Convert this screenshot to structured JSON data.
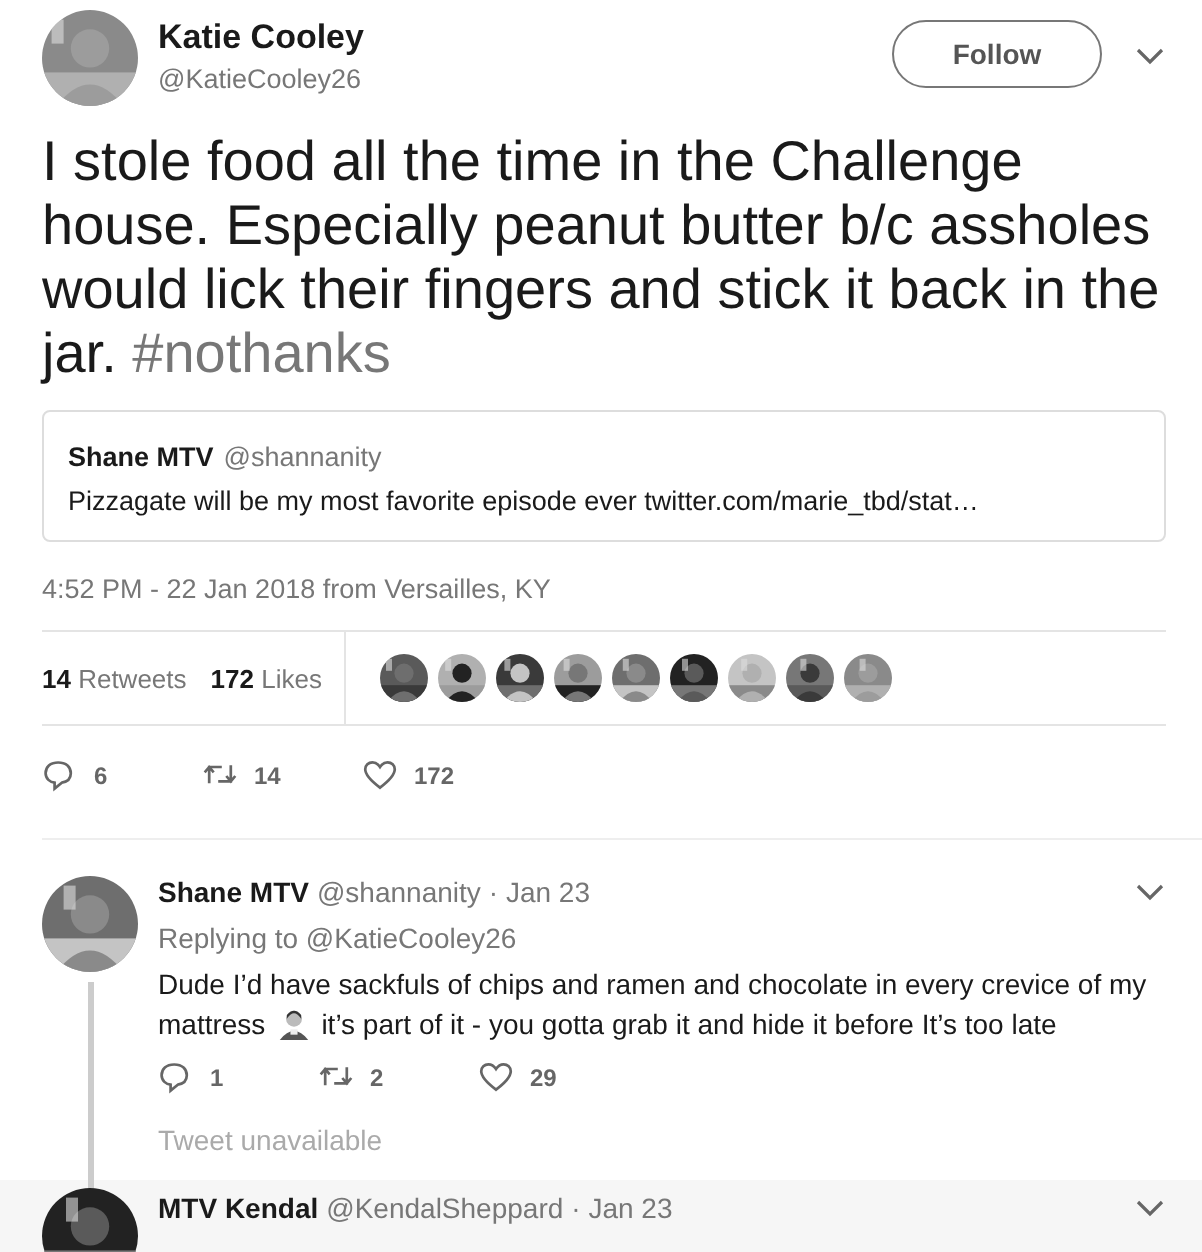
{
  "tweet": {
    "name": "Katie Cooley",
    "handle": "@KatieCooley26",
    "follow_button": "Follow",
    "text": "I stole food all the time in the Challenge house. Especially peanut butter b/c assholes would lick their fingers and stick it back in the jar.",
    "hashtag": "#nothanks",
    "quote": {
      "name": "Shane MTV",
      "handle": "@shannanity",
      "text": "Pizzagate will be my most favorite episode ever twitter.com/marie_tbd/stat…"
    },
    "timestamp": "4:52 PM - 22 Jan 2018 from Versailles, KY",
    "stats": [
      {
        "count": "14",
        "label": "Retweets"
      },
      {
        "count": "172",
        "label": "Likes"
      }
    ],
    "actions": [
      {
        "kind": "reply",
        "count": "6"
      },
      {
        "kind": "retweet",
        "count": "14"
      },
      {
        "kind": "like",
        "count": "172"
      }
    ]
  },
  "replies": [
    {
      "name": "Shane MTV",
      "handle": "@shannanity",
      "date": "· Jan 23",
      "replying_to": "Replying to @KatieCooley26",
      "text_parts": [
        {
          "kind": "line",
          "text": "Dude I’d have sackfuls of chips and ramen and chocolate in every crevice of my"
        },
        {
          "kind": "text",
          "text": "mattress"
        },
        {
          "kind": "emoji"
        },
        {
          "kind": "text",
          "text": "it’s part of it - you gotta grab it and hide it before It’s too late"
        }
      ],
      "actions": [
        {
          "kind": "reply",
          "count": "1"
        },
        {
          "kind": "retweet",
          "count": "2"
        },
        {
          "kind": "like",
          "count": "29"
        }
      ],
      "note": "Tweet unavailable"
    },
    {
      "name": "MTV Kendal",
      "handle": "@KendalSheppard",
      "date": "· Jan 23"
    }
  ]
}
